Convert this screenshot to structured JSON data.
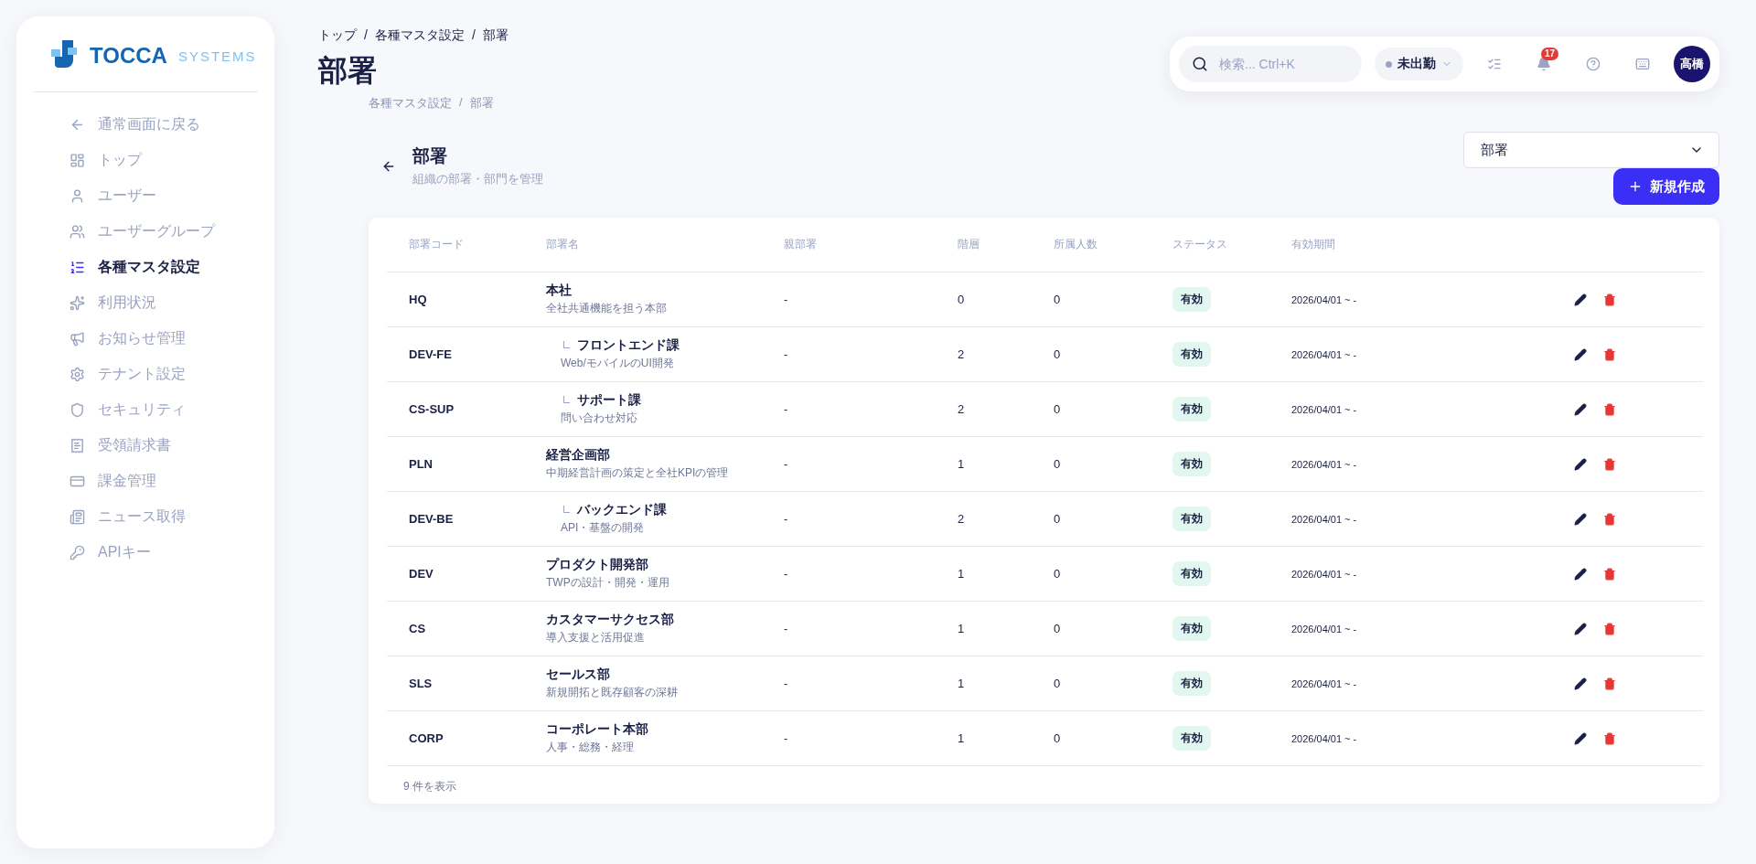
{
  "logo": {
    "name": "TOCCA",
    "suffix": "SYSTEMS"
  },
  "sidebar": {
    "items": [
      {
        "kind": "back",
        "label": "通常画面に戻る",
        "selected": false
      },
      {
        "kind": "dashboard",
        "label": "トップ",
        "selected": false
      },
      {
        "kind": "user",
        "label": "ユーザー",
        "selected": false
      },
      {
        "kind": "group",
        "label": "ユーザーグループ",
        "selected": false
      },
      {
        "kind": "master",
        "label": "各種マスタ設定",
        "selected": true
      },
      {
        "kind": "usage",
        "label": "利用状況",
        "selected": false
      },
      {
        "kind": "news",
        "label": "お知らせ管理",
        "selected": false
      },
      {
        "kind": "settings",
        "label": "テナント設定",
        "selected": false
      },
      {
        "kind": "security",
        "label": "セキュリティ",
        "selected": false
      },
      {
        "kind": "invoice",
        "label": "受領請求書",
        "selected": false
      },
      {
        "kind": "billing",
        "label": "課金管理",
        "selected": false
      },
      {
        "kind": "feed",
        "label": "ニュース取得",
        "selected": false
      },
      {
        "kind": "key",
        "label": "APIキー",
        "selected": false
      }
    ]
  },
  "breadcrumb": [
    "トップ",
    "各種マスタ設定",
    "部署"
  ],
  "breadcrumb_separator": "/",
  "page_title": "部署",
  "topbar": {
    "search_placeholder": "検索... Ctrl+K",
    "attendance": "未出勤",
    "notification_count": "17",
    "avatar": "高橋"
  },
  "sub_breadcrumb": [
    "各種マスタ設定",
    "部署"
  ],
  "section": {
    "title": "部署",
    "subtitle": "組織の部署・部門を管理",
    "select_value": "部署",
    "new_button": "新規作成"
  },
  "table": {
    "columns": [
      "部署コード",
      "部署名",
      "親部署",
      "階層",
      "所属人数",
      "ステータス",
      "有効期間"
    ],
    "rows": [
      {
        "code": "HQ",
        "name": "本社",
        "description": "全社共通機能を担う本部",
        "indented": false,
        "parent": "-",
        "level_no": "0",
        "members": "0",
        "status": "有効",
        "period": "2026/04/01 ~ -"
      },
      {
        "code": "DEV-FE",
        "name": "フロントエンド課",
        "description": "Web/モバイルのUI開発",
        "indented": true,
        "parent": "-",
        "level_no": "2",
        "members": "0",
        "status": "有効",
        "period": "2026/04/01 ~ -"
      },
      {
        "code": "CS-SUP",
        "name": "サポート課",
        "description": "問い合わせ対応",
        "indented": true,
        "parent": "-",
        "level_no": "2",
        "members": "0",
        "status": "有効",
        "period": "2026/04/01 ~ -"
      },
      {
        "code": "PLN",
        "name": "経営企画部",
        "description": "中期経営計画の策定と全社KPIの管理",
        "indented": false,
        "parent": "-",
        "level_no": "1",
        "members": "0",
        "status": "有効",
        "period": "2026/04/01 ~ -"
      },
      {
        "code": "DEV-BE",
        "name": "バックエンド課",
        "description": "API・基盤の開発",
        "indented": true,
        "parent": "-",
        "level_no": "2",
        "members": "0",
        "status": "有効",
        "period": "2026/04/01 ~ -"
      },
      {
        "code": "DEV",
        "name": "プロダクト開発部",
        "description": "TWPの設計・開発・運用",
        "indented": false,
        "parent": "-",
        "level_no": "1",
        "members": "0",
        "status": "有効",
        "period": "2026/04/01 ~ -"
      },
      {
        "code": "CS",
        "name": "カスタマーサクセス部",
        "description": "導入支援と活用促進",
        "indented": false,
        "parent": "-",
        "level_no": "1",
        "members": "0",
        "status": "有効",
        "period": "2026/04/01 ~ -"
      },
      {
        "code": "SLS",
        "name": "セールス部",
        "description": "新規開拓と既存顧客の深耕",
        "indented": false,
        "parent": "-",
        "level_no": "1",
        "members": "0",
        "status": "有効",
        "period": "2026/04/01 ~ -"
      },
      {
        "code": "CORP",
        "name": "コーポレート本部",
        "description": "人事・総務・経理",
        "indented": false,
        "parent": "-",
        "level_no": "1",
        "members": "0",
        "status": "有効",
        "period": "2026/04/01 ~ -"
      }
    ]
  },
  "footer": "9 件を表示"
}
